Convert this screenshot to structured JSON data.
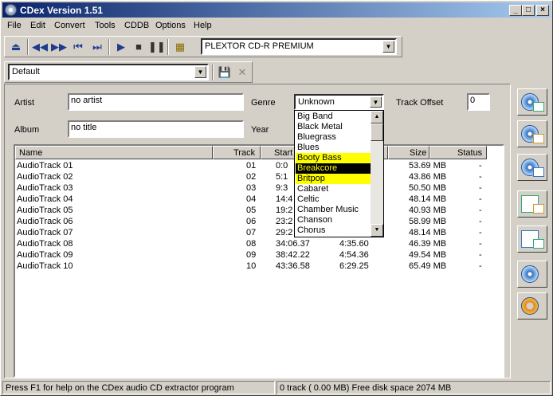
{
  "window": {
    "title": "CDex Version 1.51",
    "min": "_",
    "max": "□",
    "close": "×"
  },
  "menu": [
    "File",
    "Edit",
    "Convert",
    "Tools",
    "CDDB",
    "Options",
    "Help"
  ],
  "toolbar": {
    "drive": "PLEXTOR CD-R   PREMIUM",
    "profile": "Default"
  },
  "form": {
    "artist_label": "Artist",
    "artist_value": "no artist",
    "album_label": "Album",
    "album_value": "no title",
    "genre_label": "Genre",
    "genre_value": "Unknown",
    "year_label": "Year",
    "offset_label": "Track Offset",
    "offset_value": "0"
  },
  "list": {
    "columns": [
      "Name",
      "Track",
      "Start",
      "",
      "Size",
      "Status"
    ],
    "rows": [
      {
        "name": "AudioTrack 01",
        "track": "01",
        "start": "0:0",
        "len": "",
        "size": "53.69 MB",
        "status": "-"
      },
      {
        "name": "AudioTrack 02",
        "track": "02",
        "start": "5:1",
        "len": "",
        "size": "43.86 MB",
        "status": "-"
      },
      {
        "name": "AudioTrack 03",
        "track": "03",
        "start": "9:3",
        "len": "",
        "size": "50.50 MB",
        "status": "-"
      },
      {
        "name": "AudioTrack 04",
        "track": "04",
        "start": "14:4",
        "len": "",
        "size": "48.14 MB",
        "status": "-"
      },
      {
        "name": "AudioTrack 05",
        "track": "05",
        "start": "19:2",
        "len": "",
        "size": "40.93 MB",
        "status": "-"
      },
      {
        "name": "AudioTrack 06",
        "track": "06",
        "start": "23:2",
        "len": "",
        "size": "58.99 MB",
        "status": "-"
      },
      {
        "name": "AudioTrack 07",
        "track": "07",
        "start": "29:2",
        "len": "",
        "size": "48.14 MB",
        "status": "-"
      },
      {
        "name": "AudioTrack 08",
        "track": "08",
        "start": "34:06.37",
        "len": "4:35.60",
        "size": "46.39 MB",
        "status": "-"
      },
      {
        "name": "AudioTrack 09",
        "track": "09",
        "start": "38:42.22",
        "len": "4:54.36",
        "size": "49.54 MB",
        "status": "-"
      },
      {
        "name": "AudioTrack 10",
        "track": "10",
        "start": "43:36.58",
        "len": "6:29.25",
        "size": "65.49 MB",
        "status": "-"
      }
    ]
  },
  "genre_dropdown": {
    "items": [
      "Big Band",
      "Black Metal",
      "Bluegrass",
      "Blues",
      "Booty Bass",
      "Breakcore",
      "Britpop",
      "Cabaret",
      "Celtic",
      "Chamber Music",
      "Chanson",
      "Chorus"
    ],
    "highlighted": [
      "Booty Bass",
      "Britpop"
    ],
    "selected": "Breakcore",
    "highlight_color": "#ffff00",
    "selected_color": "#000000"
  },
  "status": {
    "help": "Press F1 for help on the CDex audio CD extractor program",
    "info": "0 track ( 0.00 MB) Free disk space  2074 MB"
  }
}
